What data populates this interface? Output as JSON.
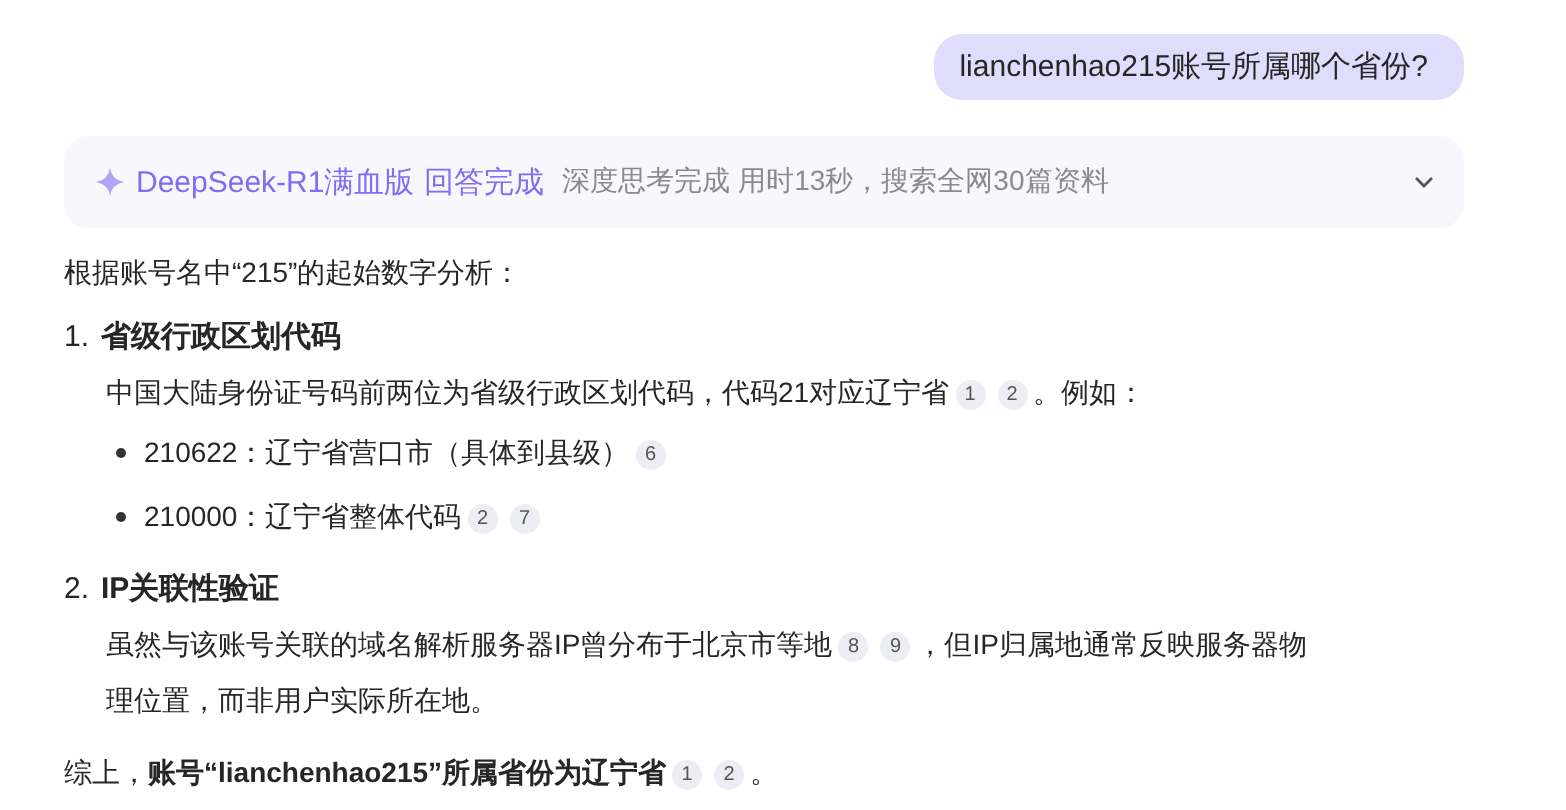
{
  "user_message": "lianchenhao215账号所属哪个省份?",
  "status_bar": {
    "model": "DeepSeek-R1满血版",
    "state": "回答完成",
    "detail": "深度思考完成 用时13秒，搜索全网30篇资料",
    "expanded": false
  },
  "intro": "根据账号名中“215”的起始数字分析：",
  "sections": [
    {
      "number": "1.",
      "title": "省级行政区划代码",
      "body": [
        {
          "kind": "text",
          "text": "中国大陆身份证号码前两位为省级行政区划代码，代码21对应辽宁省"
        },
        {
          "kind": "cite",
          "text": "1"
        },
        {
          "kind": "cite",
          "text": "2"
        },
        {
          "kind": "text",
          "text": "。例如："
        }
      ],
      "bullets": [
        [
          {
            "kind": "text",
            "text": "210622：辽宁省营口市（具体到县级）"
          },
          {
            "kind": "cite",
            "text": "6"
          }
        ],
        [
          {
            "kind": "text",
            "text": "210000：辽宁省整体代码"
          },
          {
            "kind": "cite",
            "text": "2"
          },
          {
            "kind": "cite",
            "text": "7"
          }
        ]
      ]
    },
    {
      "number": "2.",
      "title": "IP关联性验证",
      "body": [
        {
          "kind": "text",
          "text": "虽然与该账号关联的域名解析服务器IP曾分布于北京市等地"
        },
        {
          "kind": "cite",
          "text": "8"
        },
        {
          "kind": "cite",
          "text": "9"
        },
        {
          "kind": "text",
          "text": "，但IP归属地通常反映服务器物"
        },
        {
          "kind": "text",
          "text": "理位置，而非用户实际所在地。"
        }
      ]
    }
  ],
  "conclusion": [
    {
      "kind": "text",
      "text": "综上，**账号“lianchenhao215”所属省份为辽宁省**"
    },
    {
      "kind": "cite",
      "text": "1"
    },
    {
      "kind": "cite",
      "text": "2"
    },
    {
      "kind": "text",
      "text": "。"
    }
  ]
}
